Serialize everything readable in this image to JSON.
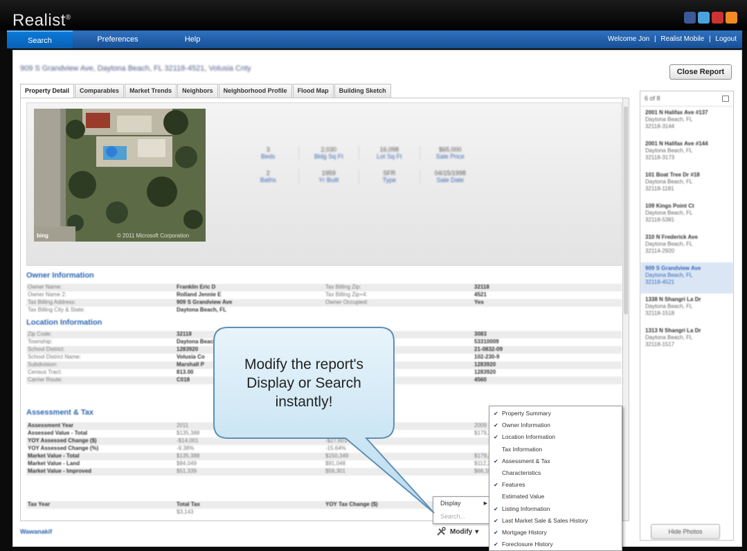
{
  "app": {
    "title": "Realist",
    "trademark": "®"
  },
  "social_icons": [
    {
      "name": "facebook-icon",
      "color": "#3b5998"
    },
    {
      "name": "twitter-icon",
      "color": "#4aa3df"
    },
    {
      "name": "youtube-icon",
      "color": "#cc3333"
    },
    {
      "name": "rss-icon",
      "color": "#f08a24"
    }
  ],
  "nav": {
    "items": [
      "Search",
      "Preferences",
      "Help"
    ],
    "active": "Search",
    "right": [
      "Welcome Jon",
      "|",
      "Realist Mobile",
      "|",
      "Logout"
    ]
  },
  "report": {
    "address": "909 S Grandview Ave, Daytona Beach, FL 32118-4521, Volusia Cnty",
    "close_label": "Close Report"
  },
  "tabs": [
    "Property Detail",
    "Comparables",
    "Market Trends",
    "Neighbors",
    "Neighborhood Profile",
    "Flood Map",
    "Building Sketch"
  ],
  "summary": {
    "photo_credit": "© 2011 Microsoft Corporation",
    "photo_logo": "bing",
    "stats": [
      [
        {
          "value": "3",
          "label": "Beds"
        },
        {
          "value": "2,030",
          "label": "Bldg Sq Ft"
        },
        {
          "value": "16,098",
          "label": "Lot Sq Ft"
        },
        {
          "value": "$65,000",
          "label": "Sale Price"
        }
      ],
      [
        {
          "value": "2",
          "label": "Baths"
        },
        {
          "value": "1959",
          "label": "Yr Built"
        },
        {
          "value": "SFR",
          "label": "Type"
        },
        {
          "value": "04/15/1998",
          "label": "Sale Date"
        }
      ]
    ]
  },
  "owner": {
    "title": "Owner Information",
    "rows": [
      [
        "Owner Name:",
        "Franklin Eric D",
        "Tax Billing Zip:",
        "32118"
      ],
      [
        "Owner Name 2:",
        "Rolland Jennie E",
        "Tax Billing Zip+4:",
        "4521"
      ],
      [
        "Tax Billing Address:",
        "909 S Grandview Ave",
        "Owner Occupied:",
        "Yes"
      ],
      [
        "Tax Billing City & State:",
        "Daytona Beach, FL",
        "",
        ""
      ]
    ]
  },
  "location": {
    "title": "Location Information",
    "rows": [
      [
        "Zip Code:",
        "32118",
        "Census Block:",
        "3083"
      ],
      [
        "Township:",
        "Daytona Beach",
        "Parcel:",
        "53310009"
      ],
      [
        "School District:",
        "1283920",
        "Legal Lot:",
        "21-0832-09"
      ],
      [
        "School District Name:",
        "Volusia Co",
        "Legal Block:",
        "102-230-9"
      ],
      [
        "Subdivision:",
        "Marshall P",
        "Legal Subdivision:",
        "1283920"
      ],
      [
        "Census Tract:",
        "813.00",
        "Neighborhood Name:",
        "1283920"
      ],
      [
        "Carrier Route:",
        "C018",
        "Flood Zone:",
        "4560"
      ]
    ]
  },
  "assessment": {
    "title": "Assessment & Tax",
    "rows": [
      [
        "Assessment Year",
        "2011",
        "2010",
        "2009"
      ],
      [
        "Assessed Value - Total",
        "$135,388",
        "$149,268",
        "$179,297"
      ],
      [
        "YOY Assessed Change ($)",
        "-$14,001",
        "-$27,601",
        ""
      ],
      [
        "YOY Assessed Change (%)",
        "-9.38%",
        "-15.64%",
        ""
      ],
      [
        "Market Value - Total",
        "$135,388",
        "$150,349",
        "$179,297"
      ],
      [
        "Market Value - Land",
        "$84,049",
        "$91,048",
        "$112,200"
      ],
      [
        "Market Value - Improved",
        "$51,339",
        "$59,301",
        "$66,100"
      ]
    ],
    "tax_header": [
      "Tax Year",
      "Total Tax",
      "YOY Tax Change ($)",
      ""
    ],
    "tax_row": [
      "",
      "$3,143",
      "",
      ""
    ]
  },
  "sidebar": {
    "header": "6 of 8",
    "properties": [
      {
        "address": "2001 N Halifax Ave #137",
        "city": "Daytona Beach, FL",
        "zip": "32118-3144"
      },
      {
        "address": "2001 N Halifax Ave #144",
        "city": "Daytona Beach, FL",
        "zip": "32118-3173"
      },
      {
        "address": "101 Boat Tree Dr #18",
        "city": "Daytona Beach, FL",
        "zip": "32118-1181"
      },
      {
        "address": "109 Kings Point Ct",
        "city": "Daytona Beach, FL",
        "zip": "32118-5381"
      },
      {
        "address": "310 N Frederick Ave",
        "city": "Daytona Beach, FL",
        "zip": "32114-2920"
      },
      {
        "address": "909 S Grandview Ave",
        "city": "Daytona Beach, FL",
        "zip": "32118-4521"
      },
      {
        "address": "1338 N Shangri La Dr",
        "city": "Daytona Beach, FL",
        "zip": "32118-1518"
      },
      {
        "address": "1313 N Shangri La Dr",
        "city": "Daytona Beach, FL",
        "zip": "32118-1517"
      }
    ],
    "selected_index": 5,
    "hide_photos_label": "Hide Photos"
  },
  "bottom_link": "Wawanakif",
  "modify": {
    "label": "Modify",
    "submenu": [
      {
        "label": "Display",
        "enabled": true
      },
      {
        "label": "Search...",
        "enabled": false
      }
    ],
    "display_options": [
      {
        "label": "Property Summary",
        "checked": true
      },
      {
        "label": "Owner Information",
        "checked": true
      },
      {
        "label": "Location Information",
        "checked": true
      },
      {
        "label": "Tax Information",
        "checked": false
      },
      {
        "label": "Assessment & Tax",
        "checked": true
      },
      {
        "label": "Characteristics",
        "checked": false
      },
      {
        "label": "Features",
        "checked": true
      },
      {
        "label": "Estimated Value",
        "checked": false
      },
      {
        "label": "Listing Information",
        "checked": true
      },
      {
        "label": "Last Market Sale & Sales History",
        "checked": true
      },
      {
        "label": "Mortgage History",
        "checked": true
      },
      {
        "label": "Foreclosure History",
        "checked": true
      }
    ]
  },
  "callout": {
    "text": "Modify the report's Display or Search instantly!"
  }
}
